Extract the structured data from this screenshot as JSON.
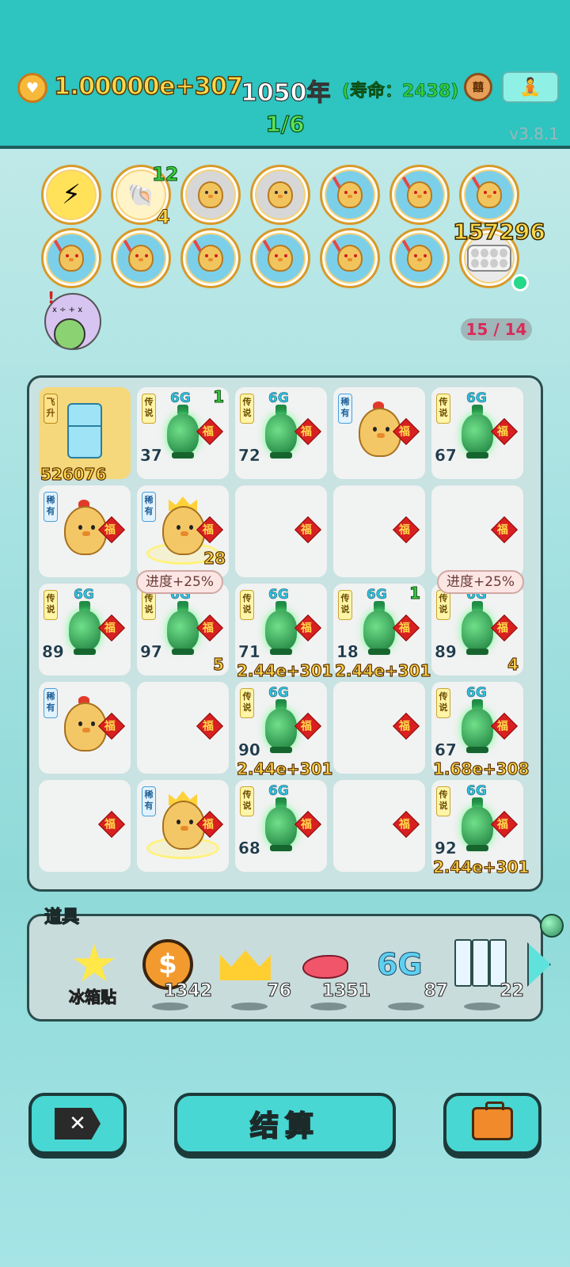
{
  "header": {
    "currency_value": "1.00000e+307",
    "year": "1050年",
    "lifespan": "(寿命：2438)",
    "fortune_glyph": "囍",
    "stage": "1/6",
    "version": "v3.8.1"
  },
  "buffs": {
    "shell_count_top": "12",
    "shell_count_bottom": "4",
    "pill_count": "157296",
    "slots": "15 / 14"
  },
  "board": {
    "cells": [
      {
        "tag": "飞升",
        "bottom": "526076"
      },
      {
        "tag": "传说",
        "sixg": "6G",
        "corner": "1",
        "left": "37"
      },
      {
        "tag": "传说",
        "sixg": "6G",
        "left": "72"
      },
      {
        "tag": "稀有"
      },
      {
        "tag": "传说",
        "sixg": "6G",
        "left": "67"
      },
      {
        "tag": "稀有"
      },
      {
        "tag": "稀有",
        "bottom": "28"
      },
      {},
      {},
      {},
      {
        "tag": "传说",
        "sixg": "6G",
        "left": "89"
      },
      {
        "tag": "传说",
        "sixg": "6G",
        "left": "97",
        "right": "5"
      },
      {
        "tag": "传说",
        "sixg": "6G",
        "left": "71",
        "bottom": "2.44e+301"
      },
      {
        "tag": "传说",
        "sixg": "6G",
        "corner": "1",
        "left": "18",
        "bottom": "2.44e+301"
      },
      {
        "tag": "传说",
        "sixg": "6G",
        "left": "89",
        "right": "4"
      },
      {
        "tag": "稀有"
      },
      {},
      {
        "tag": "传说",
        "sixg": "6G",
        "left": "90",
        "bottom": "2.44e+301"
      },
      {},
      {
        "tag": "传说",
        "sixg": "6G",
        "left": "67",
        "bottom": "1.68e+308"
      },
      {},
      {
        "tag": "稀有"
      },
      {
        "tag": "传说",
        "sixg": "6G",
        "left": "68"
      },
      {},
      {
        "tag": "传说",
        "sixg": "6G",
        "left": "92",
        "bottom": "2.44e+301"
      }
    ],
    "fu_label": "福",
    "progress_tip": "进度+25%"
  },
  "items": {
    "title": "道具",
    "sticker_label": "冰箱贴",
    "coin_count": "1342",
    "crown_count": "76",
    "liver_count": "1351",
    "g6_count": "87",
    "g6_label": "6G",
    "card_count": "22"
  },
  "buttons": {
    "settle": "结算"
  }
}
